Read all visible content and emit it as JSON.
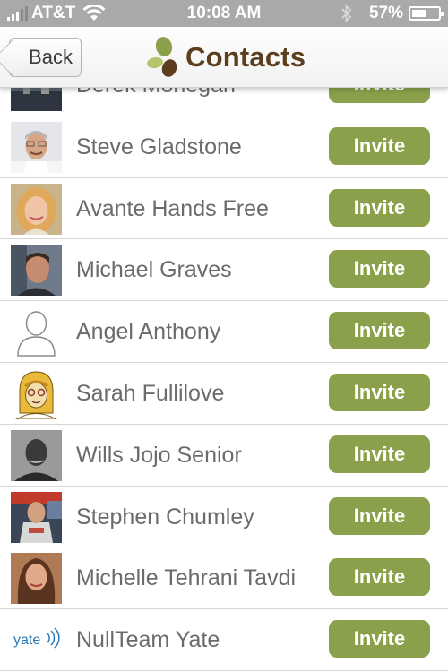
{
  "status_bar": {
    "carrier": "AT&T",
    "time": "10:08 AM",
    "battery_percent": "57%",
    "battery_level": 0.57,
    "icons": [
      "signal-icon",
      "wifi-icon",
      "bluetooth-icon",
      "battery-icon"
    ]
  },
  "nav": {
    "back_label": "Back",
    "title": "Contacts",
    "logo": "leaf-logo-icon"
  },
  "colors": {
    "accent_green": "#8aa04a",
    "title_brown": "#5c3d1e",
    "status_bar_gray": "#a9a9a9",
    "name_gray": "#6b6b6b"
  },
  "contacts": [
    {
      "name": "Derek Monegan",
      "action": "Invite",
      "avatar": "photo"
    },
    {
      "name": "Steve Gladstone",
      "action": "Invite",
      "avatar": "photo"
    },
    {
      "name": "Avante Hands Free",
      "action": "Invite",
      "avatar": "photo"
    },
    {
      "name": "Michael Graves",
      "action": "Invite",
      "avatar": "photo"
    },
    {
      "name": "Angel Anthony",
      "action": "Invite",
      "avatar": "placeholder"
    },
    {
      "name": "Sarah Fullilove",
      "action": "Invite",
      "avatar": "cartoon"
    },
    {
      "name": "Wills Jojo Senior",
      "action": "Invite",
      "avatar": "photo"
    },
    {
      "name": "Stephen Chumley",
      "action": "Invite",
      "avatar": "photo"
    },
    {
      "name": "Michelle Tehrani Tavdi",
      "action": "Invite",
      "avatar": "photo"
    },
    {
      "name": "NullTeam Yate",
      "action": "Invite",
      "avatar": "logo",
      "avatar_text": "yate"
    }
  ]
}
